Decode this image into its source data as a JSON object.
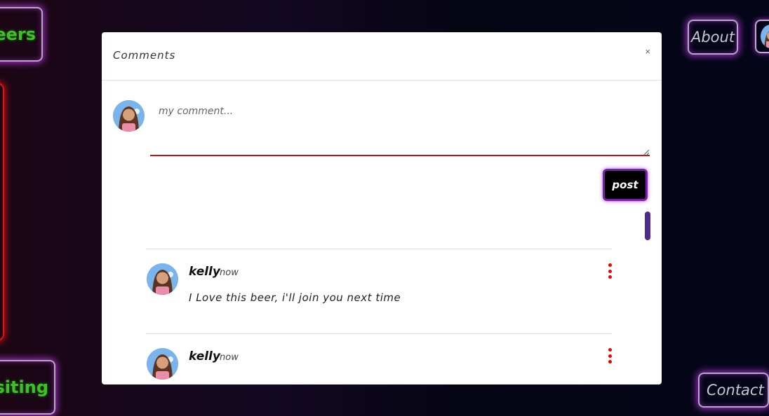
{
  "background": {
    "nav_beers_label": "eers",
    "nav_about_label": "About",
    "nav_visiting_label": "isiting",
    "nav_contact_label": "Contact"
  },
  "modal": {
    "title": "Comments",
    "close_label": "×",
    "composer": {
      "placeholder": "my comment...",
      "value": "",
      "post_label": "post"
    },
    "comments": [
      {
        "user": "kelly",
        "time": "now",
        "text": "I Love this beer, i'll join you next time"
      },
      {
        "user": "kelly",
        "time": "now",
        "text": ""
      }
    ]
  },
  "colors": {
    "accent_red": "#c31515",
    "post_border": "#7b1fb0",
    "scroll_thumb": "#4a2d8a",
    "kebab": "#ee0000"
  },
  "icons": [
    "close-icon",
    "kebab-menu-icon",
    "resize-handle-icon",
    "user-avatar"
  ]
}
